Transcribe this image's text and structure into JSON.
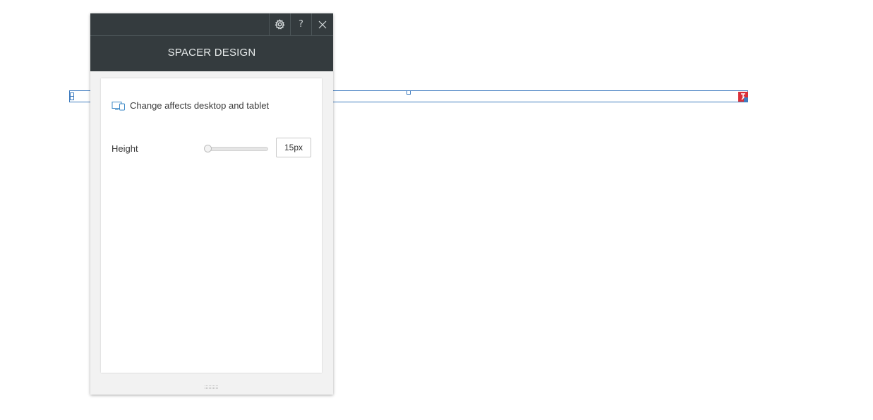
{
  "canvas": {
    "selection_color": "#3e7bbf",
    "action_color": "#d9303a"
  },
  "panel": {
    "title": "SPACER DESIGN",
    "header_color": "#343b3e",
    "buttons": {
      "settings_icon": "gear-icon",
      "help_label": "?",
      "close_icon": "close-icon"
    },
    "note": {
      "icon": "desktop-tablet-icon",
      "text": "Change affects desktop and tablet"
    },
    "height": {
      "label": "Height",
      "value": "15px",
      "slider_fraction": 0.0
    }
  }
}
